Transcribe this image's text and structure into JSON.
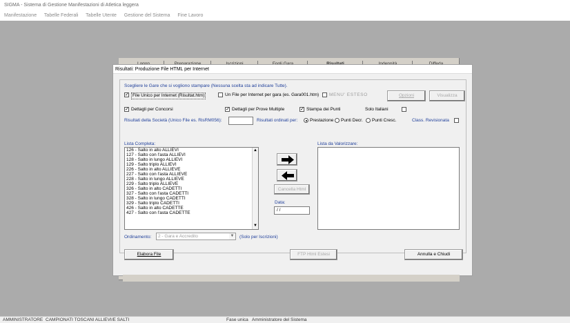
{
  "window": {
    "title": "SIGMA - Sistema di Gestione Manifestazioni di Atletica leggera"
  },
  "menu": [
    "Manifestazione",
    "Tabelle Federali",
    "Tabelle Utente",
    "Gestione del Sistema",
    "Fine Lavoro"
  ],
  "background_tabs": [
    "Logon",
    "Preparazione",
    "Iscrizioni",
    "Fogli Gara",
    "Risultati",
    "Indennità",
    "Diffeda"
  ],
  "dialog": {
    "title": "Risultati: Produzione File HTML per Internet",
    "instruction": "Scegliere le Gare che si vogliono stampare (Nessuna scelta sta ad indicare Tutte).",
    "file_unico_label": "File Unico per Internet (Risultat.htm)",
    "file_unico_checked": true,
    "un_file_label": "Un File per Internet per gara (es. Gara001.htm)",
    "un_file_checked": false,
    "menu_esteso_label": "MENU' ESTESO",
    "menu_esteso_checked": false,
    "opzioni_label": "Opzioni",
    "visualizza_label": "Visualizza",
    "dettagli_concorsi_label": "Dettagli per Concorsi",
    "dettagli_concorsi_checked": true,
    "dettagli_prove_label": "Dettagli per Prove Multiple",
    "dettagli_prove_checked": true,
    "stampa_punti_label": "Stampa dei Punti",
    "stampa_punti_checked": true,
    "solo_italiani_label": "Solo Italiani",
    "solo_italiani_checked": false,
    "societa_label": "Risultati della Società (Unico File es. RisRM056):",
    "societa_value": "",
    "ordinati_label": "Risultati ordinati per:",
    "ordinati_options": [
      "Prestazione",
      "Punti Decr.",
      "Punti Cresc."
    ],
    "ordinati_selected": "Prestazione",
    "class_revisionata_label": "Class. Revisionata",
    "class_revisionata_checked": false,
    "lista_completa_label": "Lista Completa:",
    "lista_completa": [
      "126 - Salto in alto ALLIEVI",
      "127 - Salto con l'asta ALLIEVI",
      "128 - Salto in lungo ALLIEVI",
      "129 - Salto triplo ALLIEVI",
      "226 - Salto in alto ALLIEVE",
      "227 - Salto con l'asta ALLIEVE",
      "228 - Salto in lungo ALLIEVE",
      "229 - Salto triplo ALLIEVE",
      "326 - Salto in alto CADETTI",
      "327 - Salto con l'asta CADETTI",
      "328 - Salto in lungo CADETTI",
      "329 - Salto triplo CADETTI",
      "426 - Salto in alto CADETTE",
      "427 - Salto con l'asta CADETTE"
    ],
    "lista_valorizzare_label": "Lista da Valorizzare:",
    "cancella_label": "Cancella Html",
    "data_label": "Data:",
    "data_value": "/ /",
    "ordinamento_label": "Ordinamento:",
    "ordinamento_value": "2 - Gara e Accredito",
    "ordinamento_note": "(Solo per Iscrizioni)",
    "elabora_label": "Elabora File",
    "ftp_label": "FTP Html Estesi",
    "annulla_label": "Annulla e Chiudi"
  },
  "status": {
    "user": "AMMINISTRATORE",
    "event": "CAMPIONATI TOSCANI ALLIEVI/E SALTI",
    "phase": "Fase unica",
    "role": "Amministratore del Sistema"
  }
}
